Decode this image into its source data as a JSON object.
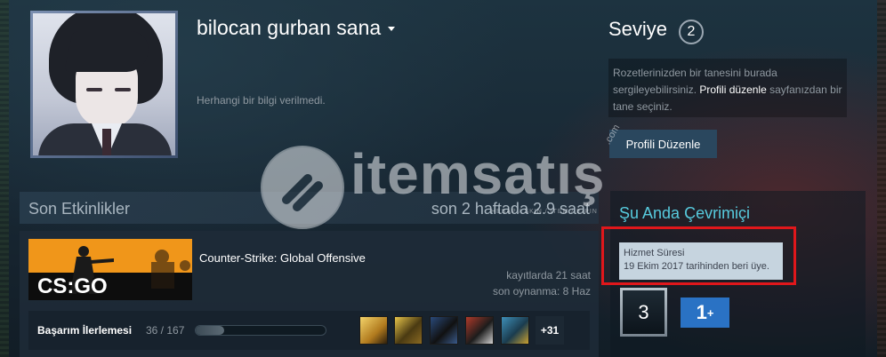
{
  "profile": {
    "username": "bilocan gurban sana",
    "summary": "Herhangi bir bilgi verilmedi."
  },
  "level": {
    "label": "Seviye",
    "value": "2",
    "badge_hint_1": "Rozetlerinizden bir tanesini burada sergileyebilirsiniz.",
    "badge_hint_link": "Profili düzenle",
    "badge_hint_2": "sayfanızdan bir tane seçiniz.",
    "edit_button": "Profili Düzenle"
  },
  "activity": {
    "title": "Son Etkinlikler",
    "hours_summary": "son 2 haftada 2.9 saat",
    "game": {
      "name": "Counter-Strike: Global Offensive",
      "capsule_text": "CS:GO",
      "total_hours": "kayıtlarda 21 saat",
      "last_played": "son oynanma: 8 Haz",
      "achievements_label": "Başarım İlerlemesi",
      "achievements_count": "36 / 167",
      "achievements_progress": 0.2156,
      "achievement_icons": [
        "achievement-icon-1",
        "achievement-icon-2",
        "achievement-icon-3",
        "achievement-icon-4",
        "achievement-icon-5"
      ],
      "achievements_more": "+31"
    }
  },
  "online": {
    "title": "Şu Anda Çevrimiçi",
    "service_label": "Hizmet Süresi",
    "service_since": "19 Ekim 2017 tarihinden beri üye.",
    "years_badge": "3",
    "plus_badge": "1",
    "plus_badge_sup": "+"
  },
  "watermark": {
    "brand": "itemsatış",
    "tagline": "HESAP / SKIN / ITEM / E-PIN",
    "domain": ".com"
  },
  "colors": {
    "accent_online": "#57cbde",
    "button_bg": "#2a475e",
    "highlight_outline": "#e0171b",
    "plus_badge_bg": "#2a72c4"
  }
}
